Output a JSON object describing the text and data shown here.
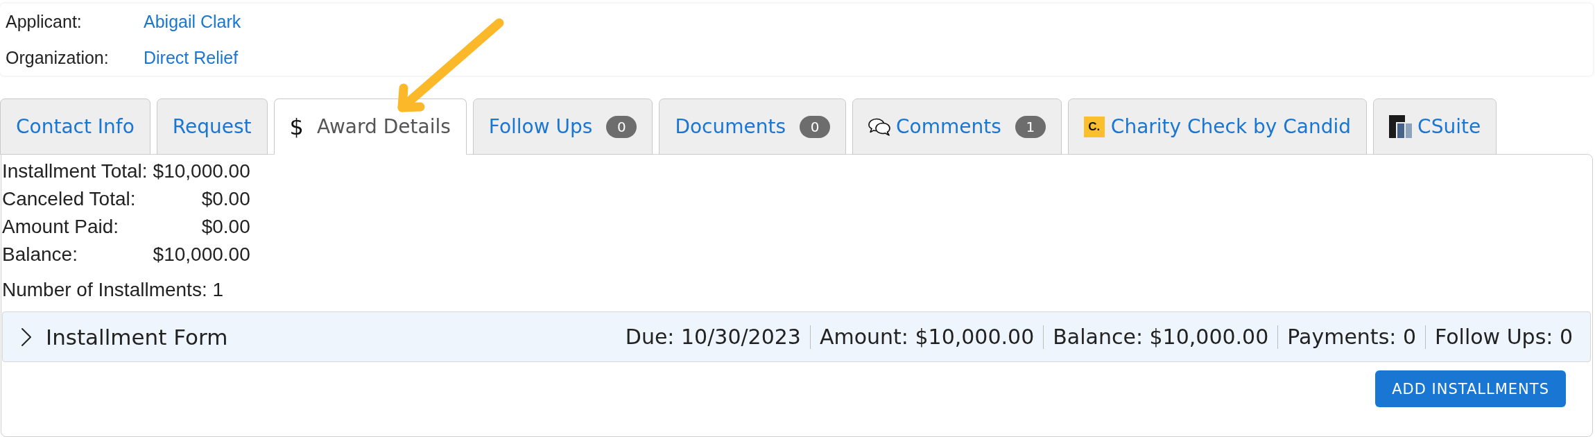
{
  "header": {
    "fields": [
      {
        "label": "Applicant:",
        "value": "Abigail Clark"
      },
      {
        "label": "Organization:",
        "value": "Direct Relief"
      }
    ]
  },
  "annotations": [
    {
      "kind": "arrow"
    }
  ],
  "tabs": [
    {
      "label": "Contact Info",
      "kind": "plain",
      "selected": false
    },
    {
      "label": "Request",
      "kind": "plain",
      "selected": false
    },
    {
      "label": "Award Details",
      "kind": "symbol",
      "symbol": "$",
      "selected": true
    },
    {
      "label": "Follow Ups",
      "kind": "plain",
      "badge": "0",
      "selected": false
    },
    {
      "label": "Documents",
      "kind": "plain",
      "badge": "0",
      "selected": false
    },
    {
      "label": "Comments",
      "kind": "chat",
      "badge": "1",
      "selected": false
    },
    {
      "label": "Charity Check by Candid",
      "kind": "lettermark",
      "mark_text": "C.",
      "selected": false
    },
    {
      "label": "CSuite",
      "kind": "logo",
      "selected": false
    }
  ],
  "summary": {
    "rows": [
      {
        "label": "Installment Total:",
        "value": "$10,000.00"
      },
      {
        "label": "Canceled Total:",
        "value": "$0.00"
      },
      {
        "label": "Amount Paid:",
        "value": "$0.00"
      },
      {
        "label": "Balance:",
        "value": "$10,000.00"
      }
    ],
    "count": "Number of Installments: 1"
  },
  "installments": [
    {
      "title": "Installment Form",
      "expanded": false,
      "fields": [
        "Due: 10/30/2023",
        "Amount: $10,000.00",
        "Balance: $10,000.00",
        "Payments: 0",
        "Follow Ups: 0"
      ]
    }
  ],
  "add_button": {
    "label": "ADD INSTALLMENTS"
  }
}
